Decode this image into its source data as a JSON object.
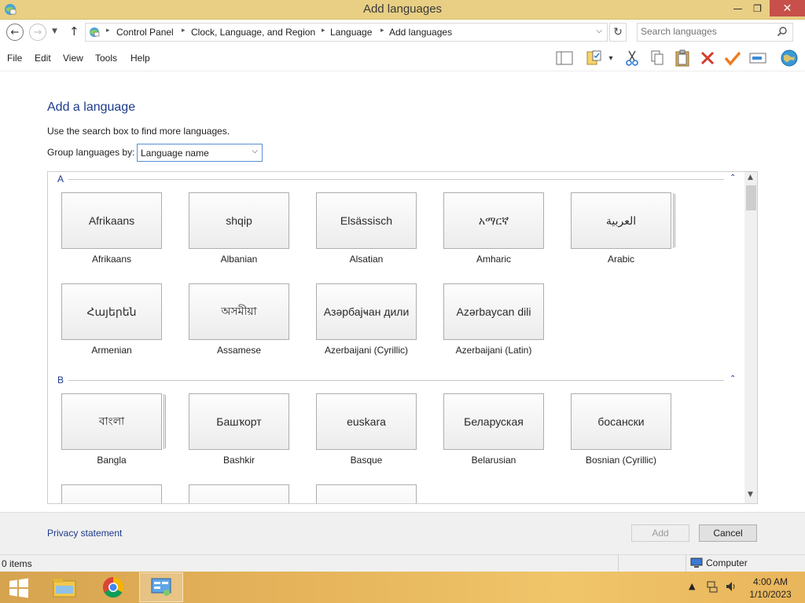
{
  "window": {
    "title": "Add languages",
    "min_glyph": "—",
    "max_glyph": "❐",
    "close_glyph": "✕"
  },
  "address": {
    "back_glyph": "←",
    "forward_glyph": "→",
    "recent_glyph": "▼",
    "up_glyph": "↑",
    "breadcrumb": [
      "Control Panel",
      "Clock, Language, and Region",
      "Language",
      "Add languages"
    ],
    "sep_glyph": "▸",
    "dropdown_glyph": "⌵",
    "refresh_glyph": "↻",
    "search_placeholder": "Search languages"
  },
  "menu": {
    "items": [
      "File",
      "Edit",
      "View",
      "Tools",
      "Help"
    ]
  },
  "toolbar": {
    "icons": [
      "layout-icon",
      "properties-icon",
      "cut-icon",
      "copy-icon",
      "paste-icon",
      "delete-icon",
      "checkmark-icon",
      "rename-icon",
      "globe-icon"
    ],
    "dropdown_glyph": "▾"
  },
  "page": {
    "heading": "Add a language",
    "hint": "Use the search box to find more languages.",
    "group_label": "Group languages by:",
    "group_value": "Language name",
    "group_arrow": "⌵"
  },
  "sections": [
    {
      "letter": "A",
      "collapse_glyph": "⌃",
      "languages": [
        {
          "native": "Afrikaans",
          "name": "Afrikaans",
          "stacked": false
        },
        {
          "native": "shqip",
          "name": "Albanian",
          "stacked": false
        },
        {
          "native": "Elsässisch",
          "name": "Alsatian",
          "stacked": false
        },
        {
          "native": "አማርኛ",
          "name": "Amharic",
          "stacked": false
        },
        {
          "native": "العربية",
          "name": "Arabic",
          "stacked": true
        },
        {
          "native": "Հայերեն",
          "name": "Armenian",
          "stacked": false
        },
        {
          "native": "অসমীয়া",
          "name": "Assamese",
          "stacked": false
        },
        {
          "native": "Азәрбајҹан дили",
          "name": "Azerbaijani (Cyrillic)",
          "stacked": false
        },
        {
          "native": "Azərbaycan dili",
          "name": "Azerbaijani (Latin)",
          "stacked": false
        }
      ]
    },
    {
      "letter": "B",
      "collapse_glyph": "⌃",
      "languages": [
        {
          "native": "বাংলা",
          "name": "Bangla",
          "stacked": true
        },
        {
          "native": "Башҡорт",
          "name": "Bashkir",
          "stacked": false
        },
        {
          "native": "euskara",
          "name": "Basque",
          "stacked": false
        },
        {
          "native": "Беларуская",
          "name": "Belarusian",
          "stacked": false
        },
        {
          "native": "босански",
          "name": "Bosnian (Cyrillic)",
          "stacked": false
        }
      ]
    }
  ],
  "scroll": {
    "up_glyph": "▲",
    "down_glyph": "▼"
  },
  "footer": {
    "privacy": "Privacy statement",
    "add": "Add",
    "cancel": "Cancel"
  },
  "status": {
    "items": "0 items",
    "computer": "Computer"
  },
  "taskbar": {
    "time": "4:00 AM",
    "date": "1/10/2023",
    "tray_arrow": "▲"
  },
  "colors": {
    "title_bar": "#e8cf84",
    "close_button": "#c7504a",
    "link": "#1e3a8c",
    "taskbar": "#e6b55c"
  }
}
